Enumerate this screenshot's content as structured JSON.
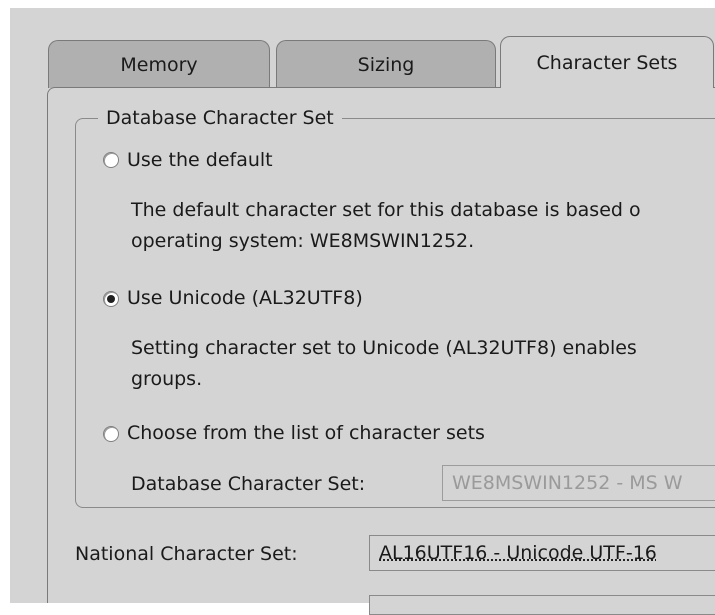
{
  "tabs": [
    {
      "label": "Memory",
      "selected": false
    },
    {
      "label": "Sizing",
      "selected": false
    },
    {
      "label": "Character Sets",
      "selected": true
    }
  ],
  "database_character_set": {
    "group_title": "Database Character Set",
    "options": [
      {
        "label": "Use the default",
        "selected": false,
        "description_line1": "The default character set for this database is based o",
        "description_line2": "operating system: WE8MSWIN1252."
      },
      {
        "label": "Use Unicode (AL32UTF8)",
        "selected": true,
        "description_line1": "Setting character set to Unicode (AL32UTF8) enables",
        "description_line2": "groups."
      },
      {
        "label": "Choose from the list of character sets",
        "selected": false
      }
    ],
    "list_label": "Database Character Set:",
    "list_value": "WE8MSWIN1252 - MS W"
  },
  "national_character_set": {
    "label": "National Character Set:",
    "value": "AL16UTF16 - Unicode UTF-16"
  }
}
